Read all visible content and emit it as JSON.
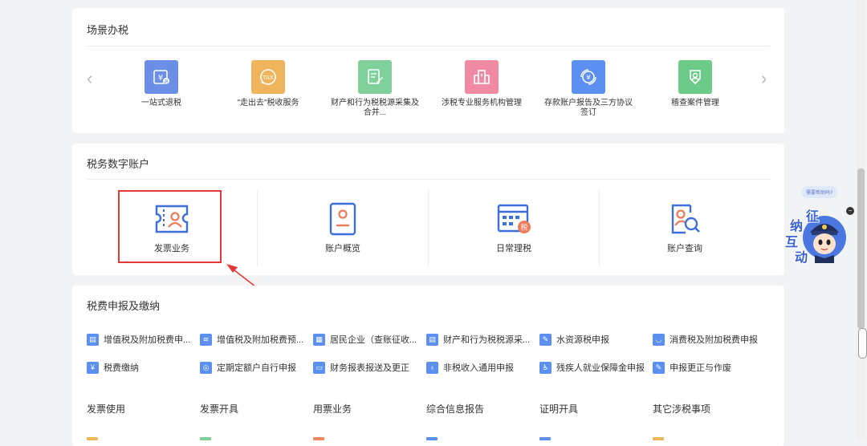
{
  "scenario": {
    "title": "场景办税",
    "prev_arrow": "‹",
    "next_arrow": "›",
    "items": [
      {
        "label": "一站式退税",
        "icon": "refund-icon",
        "color": "#6b8fe6"
      },
      {
        "label": "\"走出去\"税收服务",
        "icon": "tax-globe-icon",
        "color": "#f0b45c"
      },
      {
        "label": "财产和行为税税源采集及合并...",
        "icon": "form-edit-icon",
        "color": "#7fd09a"
      },
      {
        "label": "涉税专业服务机构管理",
        "icon": "building-icon",
        "color": "#f08aa2"
      },
      {
        "label": "存款账户报告及三方协议签订",
        "icon": "bank-account-icon",
        "color": "#5b8ff0"
      },
      {
        "label": "稽查案件管理",
        "icon": "inspection-icon",
        "color": "#6dcb8a"
      }
    ]
  },
  "account": {
    "title": "税务数字账户",
    "items": [
      {
        "label": "发票业务",
        "icon": "invoice-icon"
      },
      {
        "label": "账户概览",
        "icon": "account-overview-icon"
      },
      {
        "label": "日常理税",
        "icon": "daily-tax-icon",
        "badge": "税"
      },
      {
        "label": "账户查询",
        "icon": "account-search-icon"
      }
    ]
  },
  "declare": {
    "title": "税费申报及缴纳",
    "items": [
      {
        "label": "增值税及附加税费申...",
        "icon": "vat-form-icon",
        "color": "#5b8ff0"
      },
      {
        "label": "增值税及附加税费预...",
        "icon": "coins-stack-icon",
        "color": "#5b8ff0"
      },
      {
        "label": "居民企业（查账征收...",
        "icon": "calendar-icon",
        "color": "#5b8ff0"
      },
      {
        "label": "财产和行为税税源采...",
        "icon": "property-form-icon",
        "color": "#5b8ff0"
      },
      {
        "label": "水资源税申报",
        "icon": "water-form-icon",
        "color": "#5b8ff0"
      },
      {
        "label": "消费税及附加税费申报",
        "icon": "basket-icon",
        "color": "#5b8ff0"
      },
      {
        "label": "税费缴纳",
        "icon": "payment-icon",
        "color": "#5b8ff0"
      },
      {
        "label": "定期定额户自行申报",
        "icon": "quota-icon",
        "color": "#5b8ff0"
      },
      {
        "label": "财务报表报送及更正",
        "icon": "report-icon",
        "color": "#5b8ff0"
      },
      {
        "label": "非税收入通用申报",
        "icon": "non-tax-icon",
        "color": "#5b8ff0"
      },
      {
        "label": "残疾人就业保障金申报",
        "icon": "accessibility-icon",
        "color": "#5b8ff0"
      },
      {
        "label": "申报更正与作废",
        "icon": "correction-icon",
        "color": "#5b8ff0"
      }
    ],
    "categories": [
      {
        "label": "发票使用",
        "bar_color": "#f0b45c"
      },
      {
        "label": "发票开具",
        "bar_color": "#7fd09a"
      },
      {
        "label": "用票业务",
        "bar_color": "#f08a5c"
      },
      {
        "label": "综合信息报告",
        "bar_color": "#5b8ff0"
      },
      {
        "label": "证明开具",
        "bar_color": "#5b8ff0"
      },
      {
        "label": "其它涉税事项",
        "bar_color": "#f0b45c"
      }
    ]
  },
  "helper": {
    "bubble": "需要帮助吗?",
    "chars": [
      "征",
      "纳",
      "互",
      "动"
    ],
    "close": "−"
  },
  "colors": {
    "highlight": "#e53935",
    "accent": "#5b8ff0"
  }
}
